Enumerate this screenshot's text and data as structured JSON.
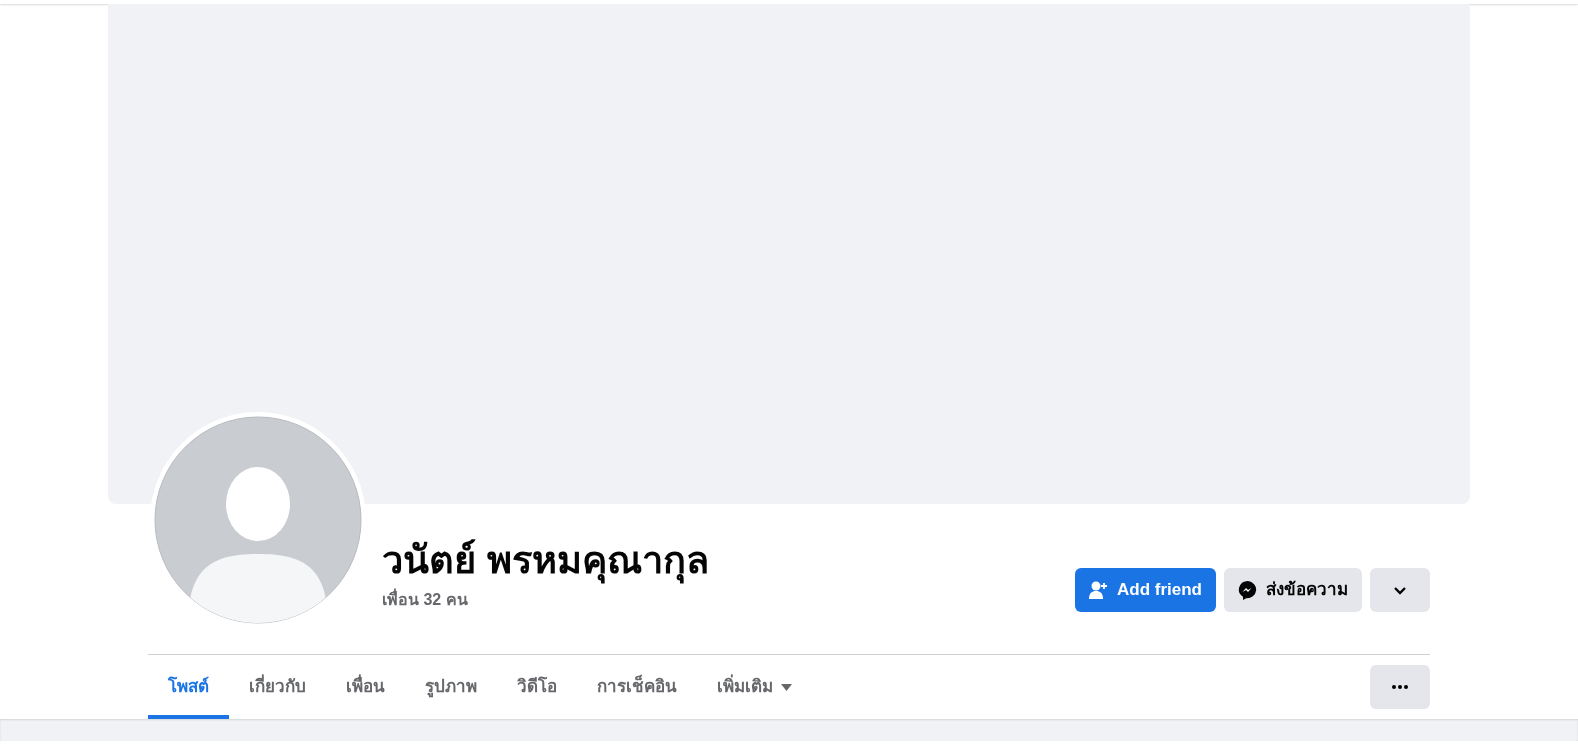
{
  "profile": {
    "name": "วนัตย์ พรหมคุณากุล",
    "friends_count": "เพื่อน 32 คน"
  },
  "actions": [
    {
      "kind": "add",
      "label": "Add friend"
    },
    {
      "kind": "message",
      "label": "ส่งข้อความ"
    },
    {
      "kind": "dropdown"
    }
  ],
  "tabs": [
    {
      "label": "โพสต์",
      "selected": true,
      "dropdown": false
    },
    {
      "label": "เกี่ยวกับ",
      "selected": false,
      "dropdown": false
    },
    {
      "label": "เพื่อน",
      "selected": false,
      "dropdown": false
    },
    {
      "label": "รูปภาพ",
      "selected": false,
      "dropdown": false
    },
    {
      "label": "วิดีโอ",
      "selected": false,
      "dropdown": false
    },
    {
      "label": "การเช็คอิน",
      "selected": false,
      "dropdown": false
    },
    {
      "label": "เพิ่มเติม",
      "selected": false,
      "dropdown": true
    }
  ]
}
